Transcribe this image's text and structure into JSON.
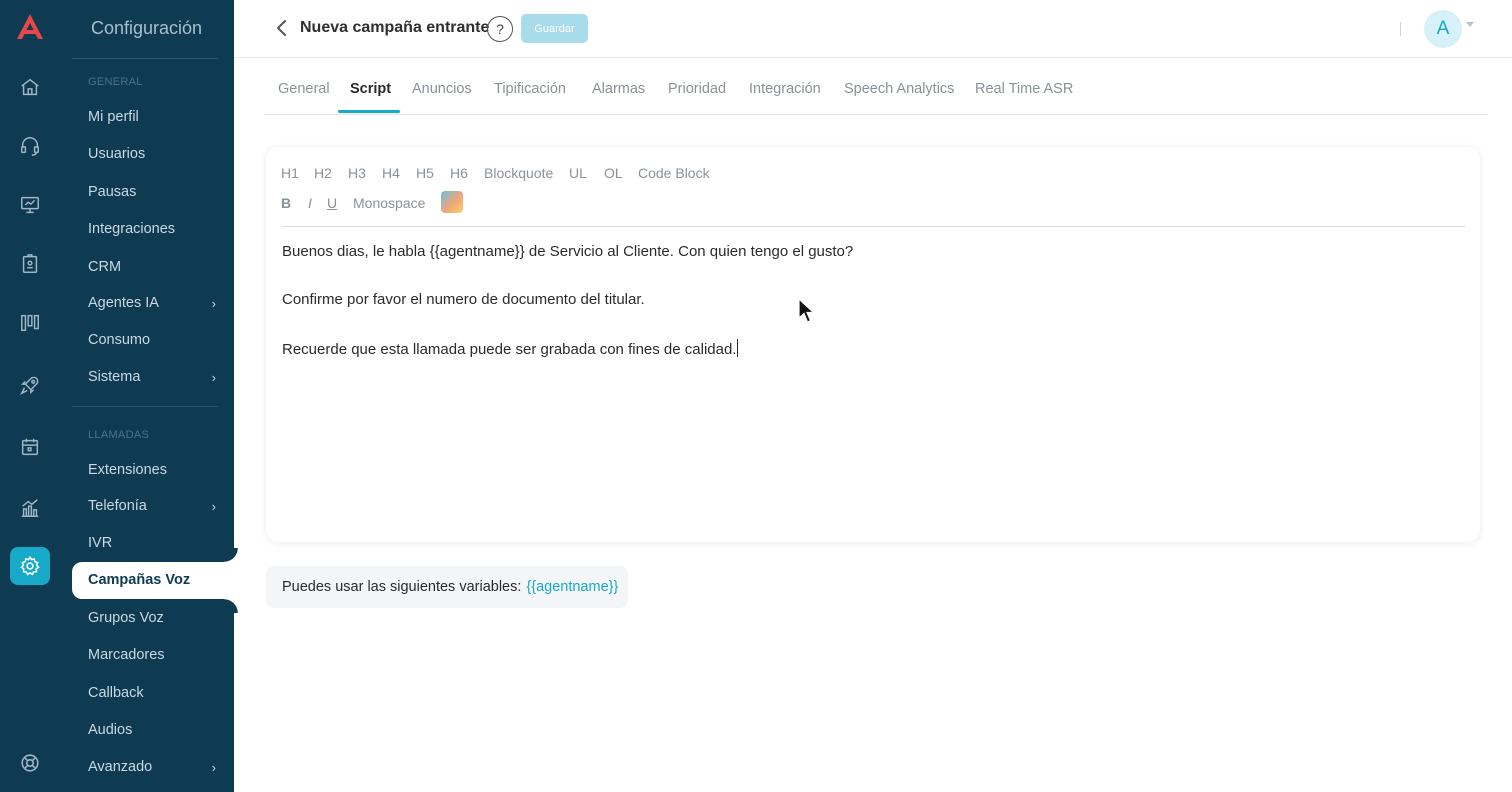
{
  "sidebar": {
    "title": "Configuración",
    "sections": [
      {
        "label": "GENERAL"
      },
      {
        "label": "LLAMADAS"
      }
    ],
    "items": [
      {
        "label": "Mi perfil"
      },
      {
        "label": "Usuarios"
      },
      {
        "label": "Pausas"
      },
      {
        "label": "Integraciones"
      },
      {
        "label": "CRM"
      },
      {
        "label": "Agentes IA",
        "chevron": "›"
      },
      {
        "label": "Consumo"
      },
      {
        "label": "Sistema",
        "chevron": "›"
      },
      {
        "label": "Extensiones"
      },
      {
        "label": "Telefonía",
        "chevron": "›"
      },
      {
        "label": "IVR"
      },
      {
        "label": "Campañas Voz",
        "active": true
      },
      {
        "label": "Grupos Voz"
      },
      {
        "label": "Marcadores"
      },
      {
        "label": "Callback"
      },
      {
        "label": "Audios"
      },
      {
        "label": "Avanzado",
        "chevron": "›"
      }
    ]
  },
  "rail": {
    "icons": [
      "app-logo",
      "home-icon",
      "headset-icon",
      "monitor-icon",
      "badge-icon",
      "kanban-icon",
      "rocket-icon",
      "calendar-icon",
      "chart-icon",
      "gear-icon",
      "support-icon"
    ],
    "active": "gear-icon"
  },
  "header": {
    "title": "Nueva campaña entrante",
    "help_label": "?",
    "save_label": "Guardar",
    "avatar_initial": "A"
  },
  "tabs": [
    {
      "label": "General"
    },
    {
      "label": "Script",
      "active": true
    },
    {
      "label": "Anuncios"
    },
    {
      "label": "Tipificación"
    },
    {
      "label": "Alarmas"
    },
    {
      "label": "Prioridad"
    },
    {
      "label": "Integración"
    },
    {
      "label": "Speech Analytics"
    },
    {
      "label": "Real Time ASR"
    }
  ],
  "editor": {
    "toolbar_row1": [
      "H1",
      "H2",
      "H3",
      "H4",
      "H5",
      "H6",
      "Blockquote",
      "UL",
      "OL",
      "Code Block"
    ],
    "toolbar_row2": [
      "B",
      "I",
      "U",
      "Monospace"
    ],
    "lines": [
      "Buenos dias, le habla {{agentname}} de Servicio al Cliente. Con quien tengo el gusto?",
      "Confirme por favor el numero de documento del titular.",
      "Recuerde que esta llamada puede ser grabada con fines de calidad."
    ]
  },
  "variables": {
    "label": "Puedes usar las siguientes variables:",
    "value": "{{agentname}}"
  },
  "colors": {
    "sidebar_bg": "#0e3a52",
    "accent": "#17a9c8",
    "save_button": "#a8dcea"
  }
}
